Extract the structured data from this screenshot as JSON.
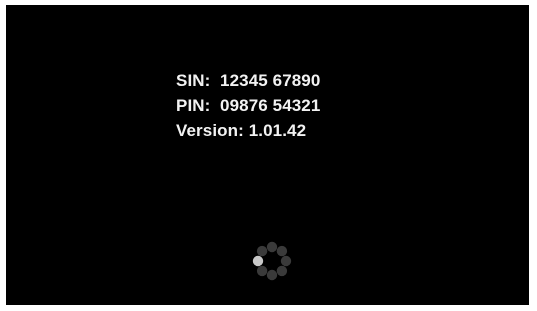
{
  "device_info": {
    "sin_line": "SIN:  12345 67890",
    "pin_line": "PIN:  09876 54321",
    "version_line": "Version: 1.01.42"
  },
  "loading_indicator": {
    "icon": "loading-spinner-icon",
    "dot_count": 8,
    "highlighted_dot_index": 6,
    "dot_color": "#3a3a3a",
    "highlight_color": "#c8c8c8"
  },
  "colors": {
    "screen_background": "#000000",
    "text": "#f2f2f2"
  }
}
